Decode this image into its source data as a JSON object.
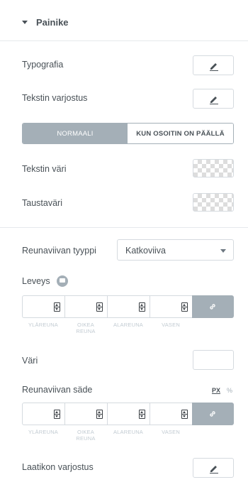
{
  "section": {
    "title": "Painike"
  },
  "typography": {
    "label": "Typografia"
  },
  "text_shadow": {
    "label": "Tekstin varjostus"
  },
  "tabs": {
    "normal": "NORMAALI",
    "hover": "KUN OSOITIN ON PÄÄLLÄ"
  },
  "text_color": {
    "label": "Tekstin väri"
  },
  "background_color": {
    "label": "Taustaväri"
  },
  "border_type": {
    "label": "Reunaviivan tyyppi",
    "value": "Katkoviiva"
  },
  "border_width": {
    "label": "Leveys",
    "sides": [
      "YLÄREUNA",
      "OIKEA REUNA",
      "ALAREUNA",
      "VASEN"
    ]
  },
  "border_color": {
    "label": "Väri"
  },
  "border_radius": {
    "label": "Reunaviivan säde",
    "unit_px": "PX",
    "unit_percent": "%",
    "sides": [
      "YLÄREUNA",
      "OIKEA REUNA",
      "ALAREUNA",
      "VASEN"
    ]
  },
  "box_shadow": {
    "label": "Laatikon varjostus"
  },
  "icons": {
    "caret": "caret-down-icon",
    "edit": "pencil-icon",
    "link": "link-icon",
    "responsive": "desktop-icon",
    "select_arrow": "chevron-down-icon"
  },
  "colors": {
    "accent_gray": "#a4afb7",
    "text": "#495157",
    "border": "#d5dadf"
  }
}
